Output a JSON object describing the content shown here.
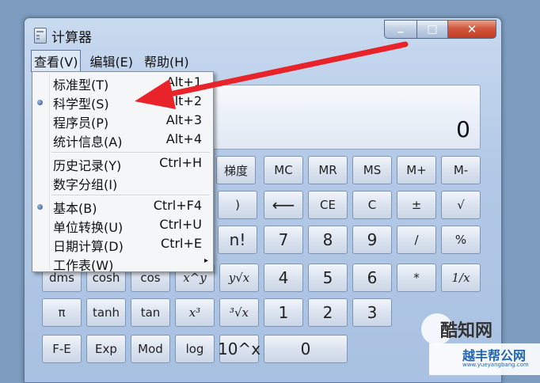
{
  "window": {
    "title": "计算器",
    "min": "▁",
    "max": "□",
    "close": "✕"
  },
  "menubar": [
    "查看(V)",
    "编辑(E)",
    "帮助(H)"
  ],
  "display": {
    "value": "0"
  },
  "menu": [
    {
      "label": "标准型(T)",
      "shortcut": "Alt+1",
      "checked": false
    },
    {
      "label": "科学型(S)",
      "shortcut": "Alt+2",
      "checked": true
    },
    {
      "label": "程序员(P)",
      "shortcut": "Alt+3",
      "checked": false
    },
    {
      "label": "统计信息(A)",
      "shortcut": "Alt+4",
      "checked": false
    },
    {
      "label": "历史记录(Y)",
      "shortcut": "Ctrl+H",
      "checked": false
    },
    {
      "label": "数字分组(I)",
      "shortcut": "",
      "checked": false
    },
    {
      "label": "基本(B)",
      "shortcut": "Ctrl+F4",
      "checked": true
    },
    {
      "label": "单位转换(U)",
      "shortcut": "Ctrl+U",
      "checked": false
    },
    {
      "label": "日期计算(D)",
      "shortcut": "Ctrl+E",
      "checked": false
    },
    {
      "label": "工作表(W)",
      "shortcut": "",
      "checked": false,
      "submenu": "▸"
    }
  ],
  "keys": {
    "row1": [
      "梯度",
      "MC",
      "MR",
      "MS",
      "M+",
      "M-"
    ],
    "row2": [
      ")",
      "⟵",
      "CE",
      "C",
      "±",
      "√"
    ],
    "row3": [
      "n!",
      "7",
      "8",
      "9",
      "/",
      "%"
    ],
    "row4": [
      "dms",
      "cosh",
      "cos",
      "x^y",
      "y√x",
      "4",
      "5",
      "6",
      "*",
      "1/x"
    ],
    "row5": [
      "π",
      "tanh",
      "tan",
      "x³",
      "³√x",
      "1",
      "2",
      "3"
    ],
    "row6": [
      "F-E",
      "Exp",
      "Mod",
      "log",
      "10^x",
      "0"
    ]
  },
  "watermark": {
    "brand": "酷知网",
    "site": "www.yueyangbang.com",
    "name": "越丰帮公网"
  },
  "colors": {
    "arrow": "#e8242a",
    "accent": "#5877a6"
  }
}
